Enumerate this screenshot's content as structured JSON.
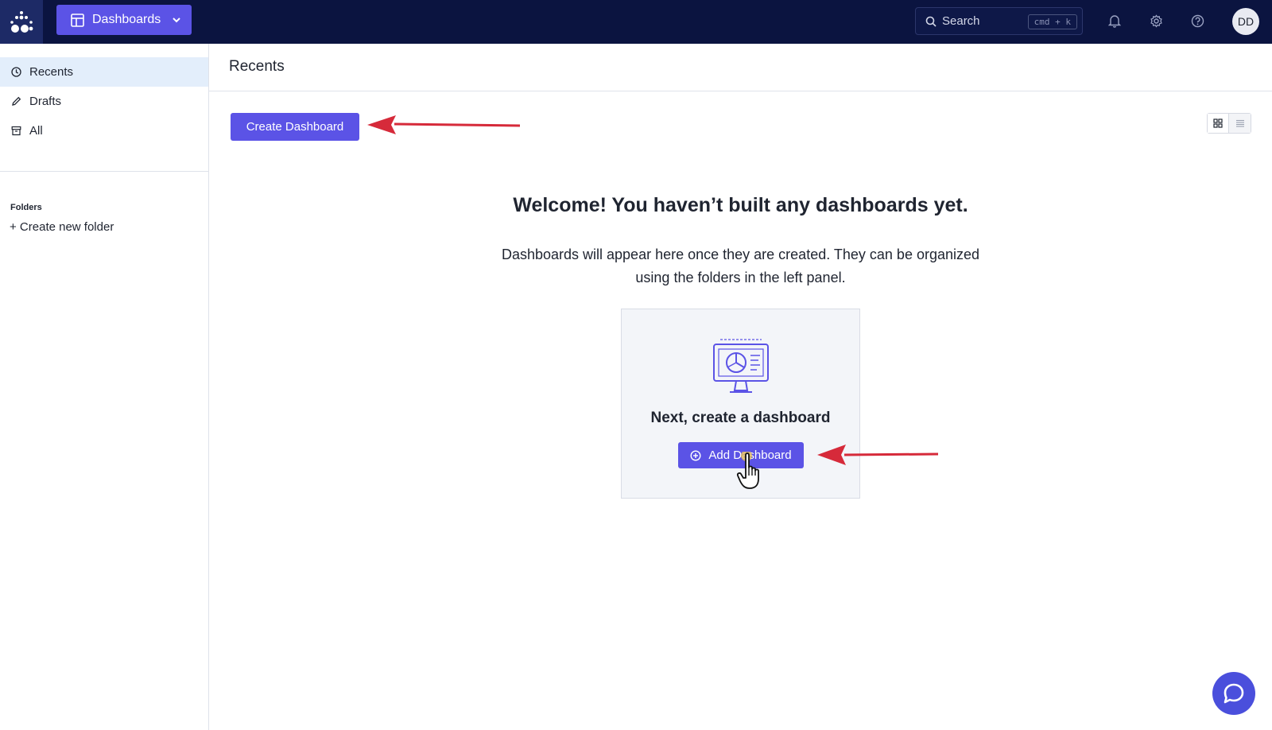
{
  "topbar": {
    "nav_label": "Dashboards",
    "search_label": "Search",
    "search_shortcut": "cmd + k",
    "avatar_initials": "DD"
  },
  "sidebar": {
    "items": [
      {
        "label": "Recents",
        "icon": "clock-icon",
        "active": true
      },
      {
        "label": "Drafts",
        "icon": "pencil-icon",
        "active": false
      },
      {
        "label": "All",
        "icon": "archive-icon",
        "active": false
      }
    ],
    "folders_title": "Folders",
    "new_folder_label": "+ Create new folder"
  },
  "main": {
    "title": "Recents",
    "create_button": "Create Dashboard",
    "view_modes": [
      "grid",
      "list"
    ],
    "welcome_title": "Welcome! You haven’t built any dashboards yet.",
    "welcome_desc_line1": "Dashboards will appear here once they are created. They can be organized",
    "welcome_desc_line2": "using the folders in the left panel.",
    "card": {
      "title": "Next, create a dashboard",
      "button": "Add Dashboard"
    }
  },
  "colors": {
    "topbar_bg": "#0b1440",
    "accent": "#5b53e6",
    "annotation_arrow": "#d62a3a",
    "active_item_bg": "#e3eefb"
  }
}
